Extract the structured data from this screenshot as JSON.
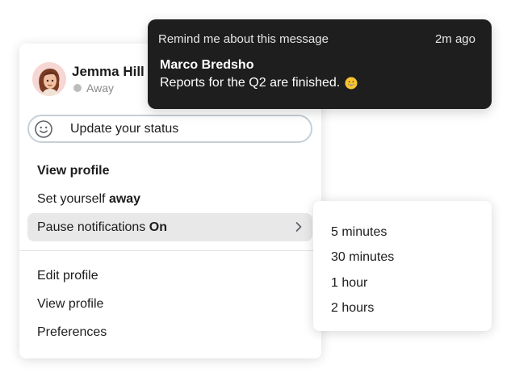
{
  "profile": {
    "name": "Jemma Hill",
    "presence": "Away",
    "presence_color": "#bdbdbd"
  },
  "status": {
    "label": "Update your status"
  },
  "menu": {
    "view_profile": "View profile",
    "set_away_prefix": "Set yourself",
    "set_away_strong": "away",
    "pause_prefix": "Pause notifications",
    "pause_state": "On",
    "edit_profile": "Edit profile",
    "view_profile_2": "View profile",
    "preferences": "Preferences"
  },
  "pause_submenu": {
    "options": [
      "5 minutes",
      "30 minutes",
      "1 hour",
      "2 hours"
    ]
  },
  "toast": {
    "header": "Remind me about this message",
    "time": "2m ago",
    "sender": "Marco Bredsho",
    "message": "Reports for the Q2 are finished.",
    "emoji": "grinning-face-emoji"
  },
  "colors": {
    "toast_bg": "#1e1e1e",
    "hover_bg": "#e8e8e8",
    "input_border": "#c5d0d6"
  }
}
